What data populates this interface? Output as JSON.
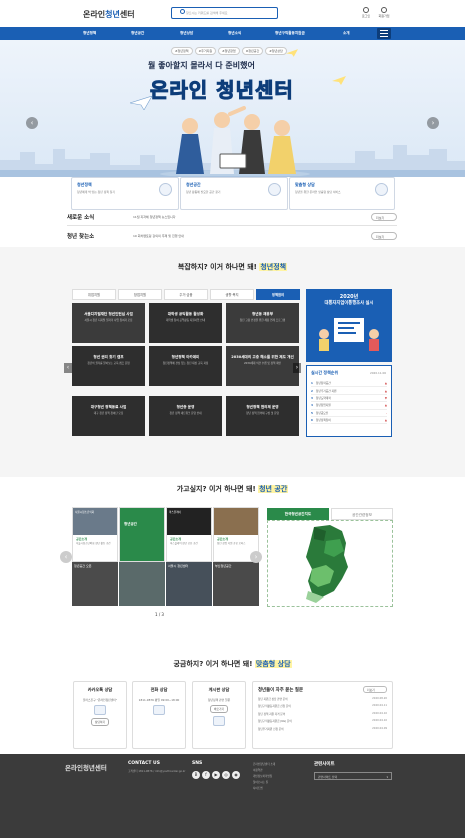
{
  "header": {
    "logo_pre": "온라인",
    "logo_hl": "청년",
    "logo_post": "센터",
    "search_placeholder": "찾으시는 키워드를 검색해 주세요",
    "login": "로그인",
    "signup": "회원가입"
  },
  "nav": [
    "청년정책",
    "청년공간",
    "청년상담",
    "청년소식",
    "청년구직활동지원금",
    "소개"
  ],
  "hero": {
    "tags": [
      "#청년정책",
      "#주거지원",
      "#청년창업",
      "#청년공간",
      "#청년상담"
    ],
    "subtitle": "뭘 좋아할지 몰라서 다 준비했어",
    "title": "온라인 청년센터"
  },
  "cards": [
    {
      "title": "청년정책",
      "desc": "청년에게 딱 맞는 청년 정책 찾기"
    },
    {
      "title": "청년공간",
      "desc": "청년 활동에 필요한 공간 찾기"
    },
    {
      "title": "맞춤형 상담",
      "desc": "청년을 위한 온라인 맞춤형 상담 서비스"
    }
  ],
  "news": {
    "label": "새로운 소식",
    "text": "11월 지자체 청년정책 뉴스입니다",
    "more": "더보기"
  },
  "events": {
    "label": "청년 찾는소",
    "text": "10 회차멘토링 강의의 주제 및 진행 안내",
    "more": "더보기"
  },
  "policy": {
    "q": "복잡하지? 이거 하나면 돼!",
    "hl": "청년정책",
    "tabs": [
      "취업지원",
      "창업지원",
      "주거·금융",
      "생활·복지",
      "정책참여"
    ],
    "active_tab": 4,
    "tiles": [
      {
        "t": "서울디지털재단 청년인턴십 사업",
        "d": "서울시 청년 디지털 일자리 사업 참여자 모집",
        "dark": false
      },
      {
        "t": "대학생 공익활동 활성화",
        "d": "대학생 참여 공익활동 지원사업 안내",
        "dark": true
      },
      {
        "t": "청년동 채용부",
        "d": "청년 고용 안정을 위한 채용 연계 프로그램",
        "dark": false
      },
      {
        "t": "청년 권리 찾기 캠프",
        "d": "청년의 권리를 알아보는 교육 캠프 운영",
        "dark": true
      },
      {
        "t": "청년정책 아카데미",
        "d": "청년정책에 관심 있는 청년 대상 교육 과정",
        "dark": true
      },
      {
        "t": "2030세대의 고충 해소를 위한 제도 개선",
        "d": "2030세대 의견 수렴 및 정책 제안",
        "dark": false
      },
      {
        "t": "대구청년 정책동료 사업",
        "d": "대구 청년 정책 참여단 모집",
        "dark": true
      },
      {
        "t": "청년층 운영",
        "d": "청년 정책 네트워크 운영 안내",
        "dark": true
      },
      {
        "t": "청년정책 협의체 운영",
        "d": "청년 정책 협의체 구성 및 운영",
        "dark": true
      }
    ],
    "banner": {
      "year": "2020년",
      "line1": "대통자지업이통행조사 실시"
    },
    "rank": {
      "title": "실시간 정책순위",
      "date": "2020.11.06",
      "items": [
        "청년창작공간",
        "청년주거공간 지원",
        "청년도약계좌",
        "청년창업지원",
        "청년공모전",
        "청년정책참여"
      ]
    }
  },
  "space": {
    "q": "가고싶지? 이거 하나면 돼!",
    "hl": "청년 공간",
    "cards": [
      {
        "img": "서울시청소년의회",
        "lab": "공간소개",
        "txt": "서울시청소년의회 청년 활동 공간"
      },
      {
        "img": "마스플레이",
        "lab": "공간소개",
        "txt": "마스플레이 청년 공유 공간"
      },
      {
        "img": "",
        "lab": "공간소개",
        "txt": "청년 창업 지원 공유 오피스"
      }
    ],
    "photos": [
      "청년공간 오픈",
      "서울시 청년센터",
      "부산청년공간"
    ],
    "map_tabs": [
      "한국청년공간지도",
      "공간관련정보"
    ],
    "pager": "1 / 3"
  },
  "consult": {
    "q": "궁금하지? 이거 하나면 돼!",
    "hl": "맞춤형 상담",
    "boxes": [
      {
        "t": "카카오톡 상담",
        "d": "플러스친구 \"온라인청년센터\"",
        "btn": "상담하기"
      },
      {
        "t": "전화 상담",
        "d": "1811-9876 평일 09:00~18:00",
        "btn": ""
      },
      {
        "t": "게시판 상담",
        "d": "청년정책 관련 질문",
        "btn": "바로가기"
      }
    ],
    "faq": {
      "title": "청년들이 자주 묻는 질문",
      "more": "더보기",
      "items": [
        {
          "q": "청년 지원금 상담 관련 문의",
          "d": "2020.08.20"
        },
        {
          "q": "청년구직활동지원금 신청 문의",
          "d": "2020.04.11"
        },
        {
          "q": "청년 정책 지원 자격 문의",
          "d": "2020.04.10"
        },
        {
          "q": "청년구직활동지원금 (KG) 문의",
          "d": "2020.04.10"
        },
        {
          "q": "청년주거지원 신청 문의",
          "d": "2020.04.09"
        }
      ]
    }
  },
  "footer": {
    "logo": "온라인청년센터",
    "contact_h": "CONTACT US",
    "contact": "고객센터 1811-9876 / info@youthcenter.go.kr",
    "sns_h": "SNS",
    "sns": [
      "B",
      "f",
      "▶",
      "◎",
      "◉"
    ],
    "links": [
      "온라인청년센터 소개",
      "이용약관",
      "개인정보처리방침",
      "찾아오시는 길",
      "사이트맵"
    ],
    "related_h": "관련사이트",
    "related_sel": "관련사이트 선택"
  }
}
